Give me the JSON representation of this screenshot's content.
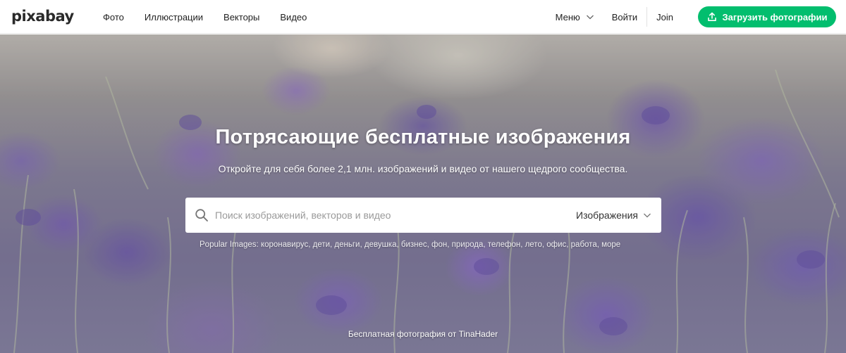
{
  "header": {
    "logo": "pixabay",
    "nav": [
      {
        "label": "Фото"
      },
      {
        "label": "Иллюстрации"
      },
      {
        "label": "Векторы"
      },
      {
        "label": "Видео"
      }
    ],
    "menu_label": "Меню",
    "login_label": "Войти",
    "join_label": "Join",
    "upload_label": "Загрузить фотографии",
    "upload_icon": "upload-icon",
    "accent_color": "#02be6e"
  },
  "hero": {
    "title": "Потрясающие бесплатные изображения",
    "subtitle": "Откройте для себя более 2,1 млн. изображений и видео от нашего щедрого сообщества.",
    "search": {
      "placeholder": "Поиск изображений, векторов и видео",
      "value": "",
      "type_label": "Изображения"
    },
    "popular_prefix": "Popular Images:",
    "popular_tags": "коронавирус, дети, деньги, девушка, бизнес, фон, природа, телефон, лето, офис, работа, море",
    "credit": "Бесплатная фотография от TinaHader"
  }
}
